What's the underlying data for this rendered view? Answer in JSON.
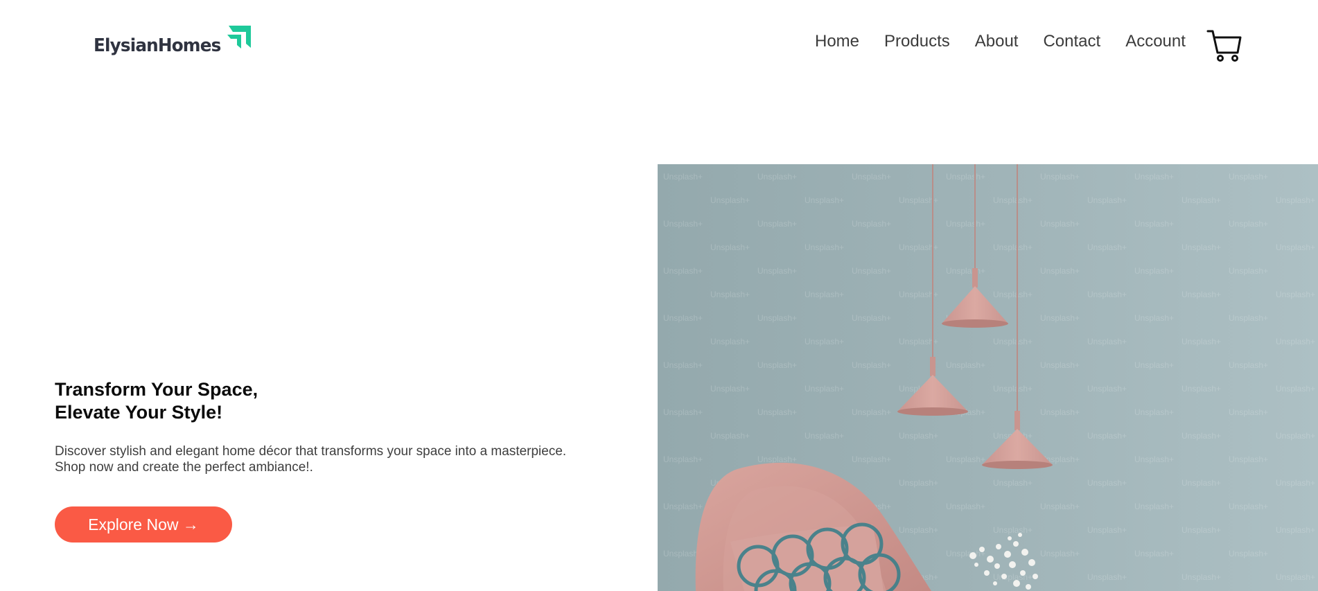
{
  "brand": {
    "name": "ElysianHomes",
    "accent_color": "#1ec99a",
    "text_color": "#2f3340"
  },
  "nav": {
    "items": [
      {
        "label": "Home"
      },
      {
        "label": "Products"
      },
      {
        "label": "About"
      },
      {
        "label": "Contact"
      },
      {
        "label": "Account"
      }
    ],
    "cart_icon": "shopping-cart-icon"
  },
  "hero": {
    "title": "Transform Your Space,\nElevate Your Style!",
    "description": "Discover stylish and elegant home décor that transforms your space into a masterpiece.\nShop now and create the perfect ambiance!.",
    "cta_label": "Explore Now →",
    "cta_color": "#fa5a45",
    "image": {
      "subject": "pink armchair with patterned cushion under three pink pendant lamps against a grey-blue wall",
      "watermark": "Unsplash+",
      "wall_color": "#a1b5b9",
      "accent_color": "#d9a39d"
    }
  }
}
